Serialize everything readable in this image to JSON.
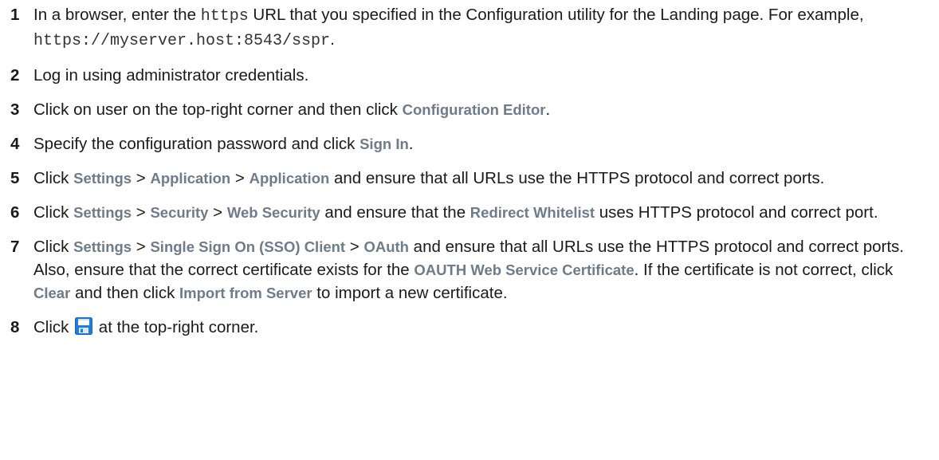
{
  "steps": [
    {
      "num": "1",
      "segments": [
        {
          "t": "text",
          "v": "In a browser, enter the "
        },
        {
          "t": "code",
          "v": "https"
        },
        {
          "t": "text",
          "v": " URL that you specified in the Configuration utility for the Landing page. For example, "
        },
        {
          "t": "code",
          "v": "https://myserver.host:8543/sspr"
        },
        {
          "t": "text",
          "v": "."
        }
      ]
    },
    {
      "num": "2",
      "segments": [
        {
          "t": "text",
          "v": "Log in using administrator credentials."
        }
      ]
    },
    {
      "num": "3",
      "segments": [
        {
          "t": "text",
          "v": "Click on user on the top-right corner and then click "
        },
        {
          "t": "ui",
          "v": "Configuration Editor"
        },
        {
          "t": "text",
          "v": "."
        }
      ]
    },
    {
      "num": "4",
      "segments": [
        {
          "t": "text",
          "v": "Specify the configuration password and click "
        },
        {
          "t": "ui",
          "v": "Sign In"
        },
        {
          "t": "text",
          "v": "."
        }
      ]
    },
    {
      "num": "5",
      "segments": [
        {
          "t": "text",
          "v": "Click "
        },
        {
          "t": "ui",
          "v": "Settings"
        },
        {
          "t": "text",
          "v": " > "
        },
        {
          "t": "ui",
          "v": "Application"
        },
        {
          "t": "text",
          "v": " > "
        },
        {
          "t": "ui",
          "v": "Application"
        },
        {
          "t": "text",
          "v": " and ensure that all URLs use the HTTPS protocol and correct ports."
        }
      ]
    },
    {
      "num": "6",
      "segments": [
        {
          "t": "text",
          "v": "Click "
        },
        {
          "t": "ui",
          "v": "Settings"
        },
        {
          "t": "text",
          "v": " > "
        },
        {
          "t": "ui",
          "v": "Security"
        },
        {
          "t": "text",
          "v": " > "
        },
        {
          "t": "ui",
          "v": "Web Security"
        },
        {
          "t": "text",
          "v": " and ensure that the "
        },
        {
          "t": "ui",
          "v": "Redirect Whitelist"
        },
        {
          "t": "text",
          "v": " uses HTTPS protocol and correct port."
        }
      ]
    },
    {
      "num": "7",
      "segments": [
        {
          "t": "text",
          "v": "Click "
        },
        {
          "t": "ui",
          "v": "Settings"
        },
        {
          "t": "text",
          "v": " > "
        },
        {
          "t": "ui",
          "v": "Single Sign On (SSO) Client"
        },
        {
          "t": "text",
          "v": " > "
        },
        {
          "t": "ui",
          "v": "OAuth"
        },
        {
          "t": "text",
          "v": " and ensure that all URLs use the HTTPS protocol and correct ports. Also, ensure that the correct certificate exists for the "
        },
        {
          "t": "ui",
          "v": "OAUTH Web Service Certificate"
        },
        {
          "t": "text",
          "v": ". If the certificate is not correct, click "
        },
        {
          "t": "ui",
          "v": "Clear"
        },
        {
          "t": "text",
          "v": " and then click "
        },
        {
          "t": "ui",
          "v": "Import from Server"
        },
        {
          "t": "text",
          "v": " to import a new certificate."
        }
      ]
    },
    {
      "num": "8",
      "segments": [
        {
          "t": "text",
          "v": "Click "
        },
        {
          "t": "icon",
          "v": "save-icon"
        },
        {
          "t": "text",
          "v": " at the top-right corner."
        }
      ]
    }
  ],
  "colors": {
    "text": "#1a1a1a",
    "ui_term": "#6d7b8c",
    "save_icon": "#1f7ed6"
  }
}
